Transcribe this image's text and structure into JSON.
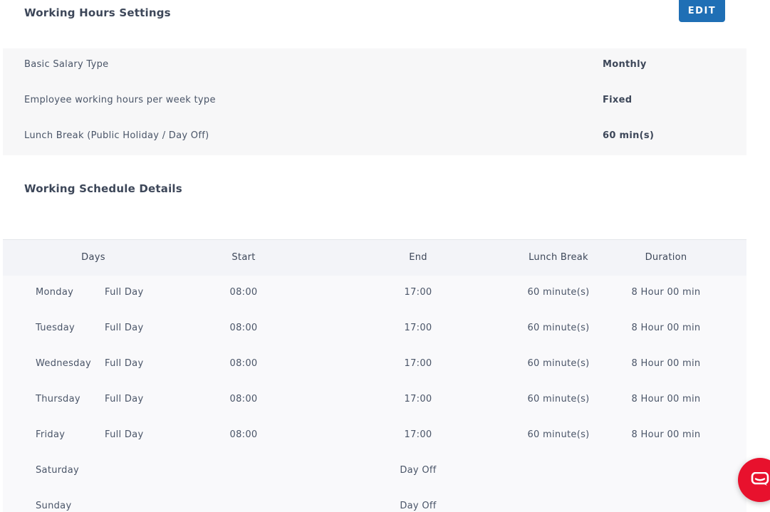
{
  "working_hours": {
    "title": "Working Hours Settings",
    "edit_label": "EDIT",
    "settings": [
      {
        "label": "Basic Salary Type",
        "value": "Monthly"
      },
      {
        "label": "Employee working hours per week type",
        "value": "Fixed"
      },
      {
        "label": "Lunch Break (Public Holiday / Day Off)",
        "value": "60 min(s)"
      }
    ]
  },
  "schedule": {
    "title": "Working Schedule Details",
    "headers": {
      "days": "Days",
      "start": "Start",
      "end": "End",
      "lunch": "Lunch Break",
      "duration": "Duration"
    },
    "rows": [
      {
        "day": "Monday",
        "type": "Full Day",
        "start": "08:00",
        "end": "17:00",
        "lunch": "60 minute(s)",
        "duration": "8 Hour 00 min"
      },
      {
        "day": "Tuesday",
        "type": "Full Day",
        "start": "08:00",
        "end": "17:00",
        "lunch": "60 minute(s)",
        "duration": "8 Hour 00 min"
      },
      {
        "day": "Wednesday",
        "type": "Full Day",
        "start": "08:00",
        "end": "17:00",
        "lunch": "60 minute(s)",
        "duration": "8 Hour 00 min"
      },
      {
        "day": "Thursday",
        "type": "Full Day",
        "start": "08:00",
        "end": "17:00",
        "lunch": "60 minute(s)",
        "duration": "8 Hour 00 min"
      },
      {
        "day": "Friday",
        "type": "Full Day",
        "start": "08:00",
        "end": "17:00",
        "lunch": "60 minute(s)",
        "duration": "8 Hour 00 min"
      },
      {
        "day": "Saturday",
        "type": "",
        "start": "",
        "end": "Day Off",
        "lunch": "",
        "duration": ""
      },
      {
        "day": "Sunday",
        "type": "",
        "start": "",
        "end": "Day Off",
        "lunch": "",
        "duration": ""
      }
    ]
  },
  "chat_widget": {
    "icon": "chat-icon",
    "color": "#e8112d"
  },
  "colors": {
    "accent": "#1f6fb5",
    "text": "#4a5568",
    "heading": "#3d4759"
  }
}
